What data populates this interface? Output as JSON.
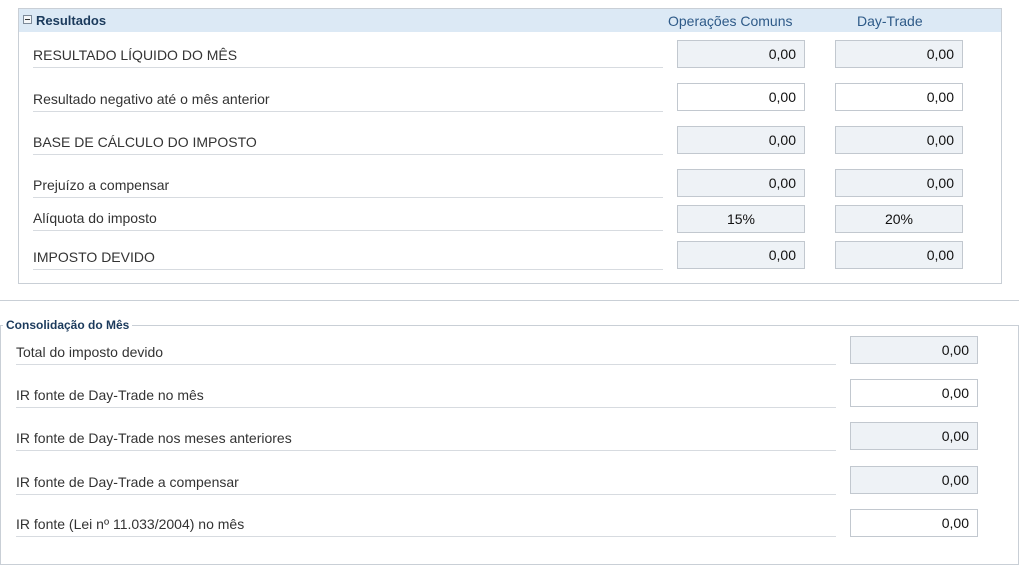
{
  "resultados": {
    "title": "Resultados",
    "col_comuns": "Operações Comuns",
    "col_daytrade": "Day-Trade",
    "rows": [
      {
        "label": "RESULTADO LÍQUIDO DO MÊS",
        "comuns": "0,00",
        "daytrade": "0,00"
      },
      {
        "label": "Resultado negativo até o mês anterior",
        "comuns": "0,00",
        "daytrade": "0,00"
      },
      {
        "label": "BASE DE CÁLCULO DO IMPOSTO",
        "comuns": "0,00",
        "daytrade": "0,00"
      },
      {
        "label": "Prejuízo a compensar",
        "comuns": "0,00",
        "daytrade": "0,00"
      },
      {
        "label": "Alíquota do imposto",
        "comuns": "15%",
        "daytrade": "20%"
      },
      {
        "label": "IMPOSTO DEVIDO",
        "comuns": "0,00",
        "daytrade": "0,00"
      }
    ]
  },
  "consolidacao": {
    "title": "Consolidação do Mês",
    "rows": [
      {
        "label": "Total do imposto devido",
        "value": "0,00"
      },
      {
        "label": "IR fonte de Day-Trade no mês",
        "value": "0,00"
      },
      {
        "label": "IR fonte de Day-Trade nos meses anteriores",
        "value": "0,00"
      },
      {
        "label": "IR fonte de Day-Trade a compensar",
        "value": "0,00"
      },
      {
        "label": "IR fonte (Lei nº 11.033/2004) no mês",
        "value": "0,00"
      }
    ]
  }
}
